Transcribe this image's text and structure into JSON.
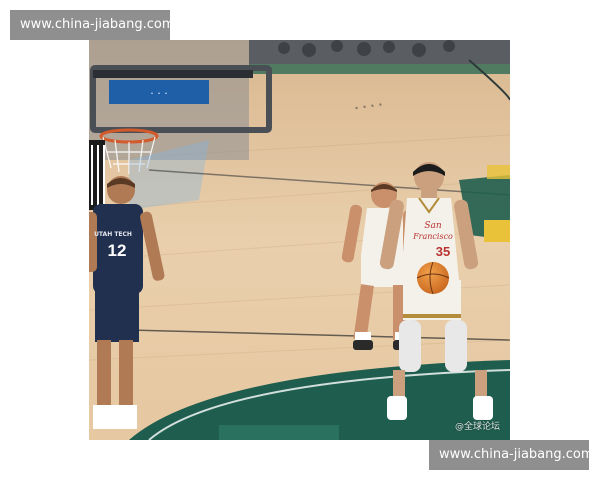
{
  "watermarks": {
    "top": "www.china-jiabang.com",
    "bottom": "www.china-jiabang.com"
  },
  "photo": {
    "corner_mark": "@全球论坛",
    "jerseys": {
      "left_player_team": "UTAH TECH",
      "left_player_number": "12",
      "shooter_team_line1": "San",
      "shooter_team_line2": "Francisco",
      "shooter_number": "35"
    },
    "colors": {
      "court_wood": "#e8cba6",
      "court_green": "#1f5e4e",
      "court_yellow": "#e9c23a",
      "navy_jersey": "#22304f",
      "white_jersey": "#f4f1ea",
      "jersey_red": "#b8322f",
      "ball_orange": "#e0802a"
    }
  }
}
